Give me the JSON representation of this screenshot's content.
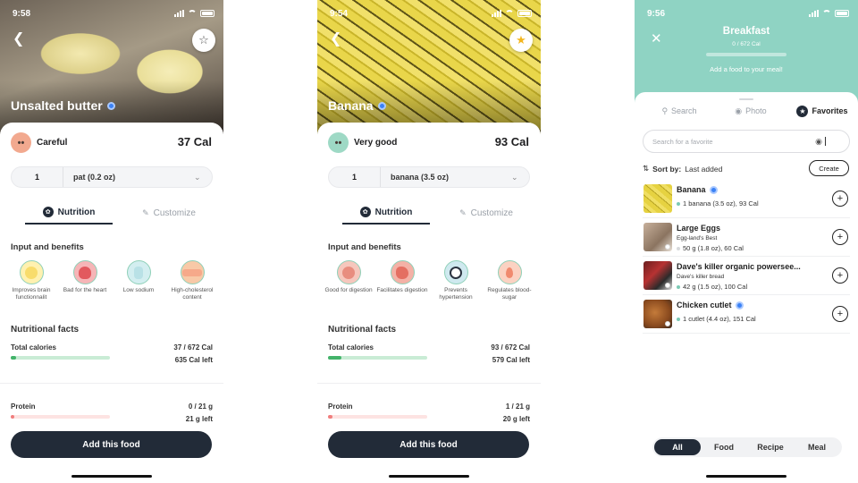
{
  "screens": [
    {
      "status_time": "9:58",
      "food_name": "Unsalted butter",
      "favorite": false,
      "rating_label": "Careful",
      "calories": "37 Cal",
      "serving_qty": "1",
      "serving_unit": "pat (0.2 oz)",
      "tabs": {
        "nutrition": "Nutrition",
        "customize": "Customize"
      },
      "benefits_heading": "Input and benefits",
      "benefits": [
        {
          "label": "Improves brain functionnalit",
          "icon": "brain-icon"
        },
        {
          "label": "Bad for the heart",
          "icon": "heart-icon"
        },
        {
          "label": "Low sodium",
          "icon": "salt-shaker-icon"
        },
        {
          "label": "High-cholesterol content",
          "icon": "cholesterol-icon"
        }
      ],
      "facts_heading": "Nutritional facts",
      "facts": [
        {
          "label": "Total calories",
          "value": "37 / 672 Cal",
          "left": "635 Cal left",
          "progress": 0.055
        },
        {
          "label": "Protein",
          "value": "0 / 21 g",
          "left": "21 g left",
          "progress": 0.0
        }
      ],
      "add_button": "Add this food"
    },
    {
      "status_time": "9:54",
      "food_name": "Banana",
      "favorite": true,
      "rating_label": "Very good",
      "calories": "93 Cal",
      "serving_qty": "1",
      "serving_unit": "banana (3.5 oz)",
      "tabs": {
        "nutrition": "Nutrition",
        "customize": "Customize"
      },
      "benefits_heading": "Input and benefits",
      "benefits": [
        {
          "label": "Good for digestion",
          "icon": "intestine-icon"
        },
        {
          "label": "Facilitates digestion",
          "icon": "stomach-icon"
        },
        {
          "label": "Prevents hypertension",
          "icon": "blood-pressure-icon"
        },
        {
          "label": "Regulates blood-sugar",
          "icon": "blood-sugar-icon"
        }
      ],
      "facts_heading": "Nutritional facts",
      "facts": [
        {
          "label": "Total calories",
          "value": "93 / 672 Cal",
          "left": "579 Cal left",
          "progress": 0.138
        },
        {
          "label": "Protein",
          "value": "1 / 21 g",
          "left": "20 g left",
          "progress": 0.048
        }
      ],
      "add_button": "Add this food"
    }
  ],
  "meal": {
    "status_time": "9:56",
    "title": "Breakfast",
    "calories": "0 / 672 Cal",
    "hint": "Add a food to your meal!",
    "tabs": [
      "Search",
      "Photo",
      "Favorites"
    ],
    "search_placeholder": "Search for a favorite",
    "sort_label": "Sort by:",
    "sort_value": "Last added",
    "create_label": "Create",
    "favorites": [
      {
        "name": "Banana",
        "brand": "",
        "desc": "1 banana (3.5 oz), 93 Cal",
        "verified": true,
        "thumb": "banana"
      },
      {
        "name": "Large Eggs",
        "brand": "Egg-land's Best",
        "desc": "50 g (1.8 oz), 60 Cal",
        "verified": false,
        "thumb": "eggs"
      },
      {
        "name": "Dave's killer organic powersee...",
        "brand": "Dave's killer bread",
        "desc": "42 g (1.5 oz), 100 Cal",
        "verified": false,
        "thumb": "bread"
      },
      {
        "name": "Chicken cutlet",
        "brand": "",
        "desc": "1 cutlet (4.4 oz), 151 Cal",
        "verified": true,
        "thumb": "chicken"
      }
    ],
    "filters": [
      "All",
      "Food",
      "Recipe",
      "Meal"
    ],
    "active_filter": "All"
  }
}
